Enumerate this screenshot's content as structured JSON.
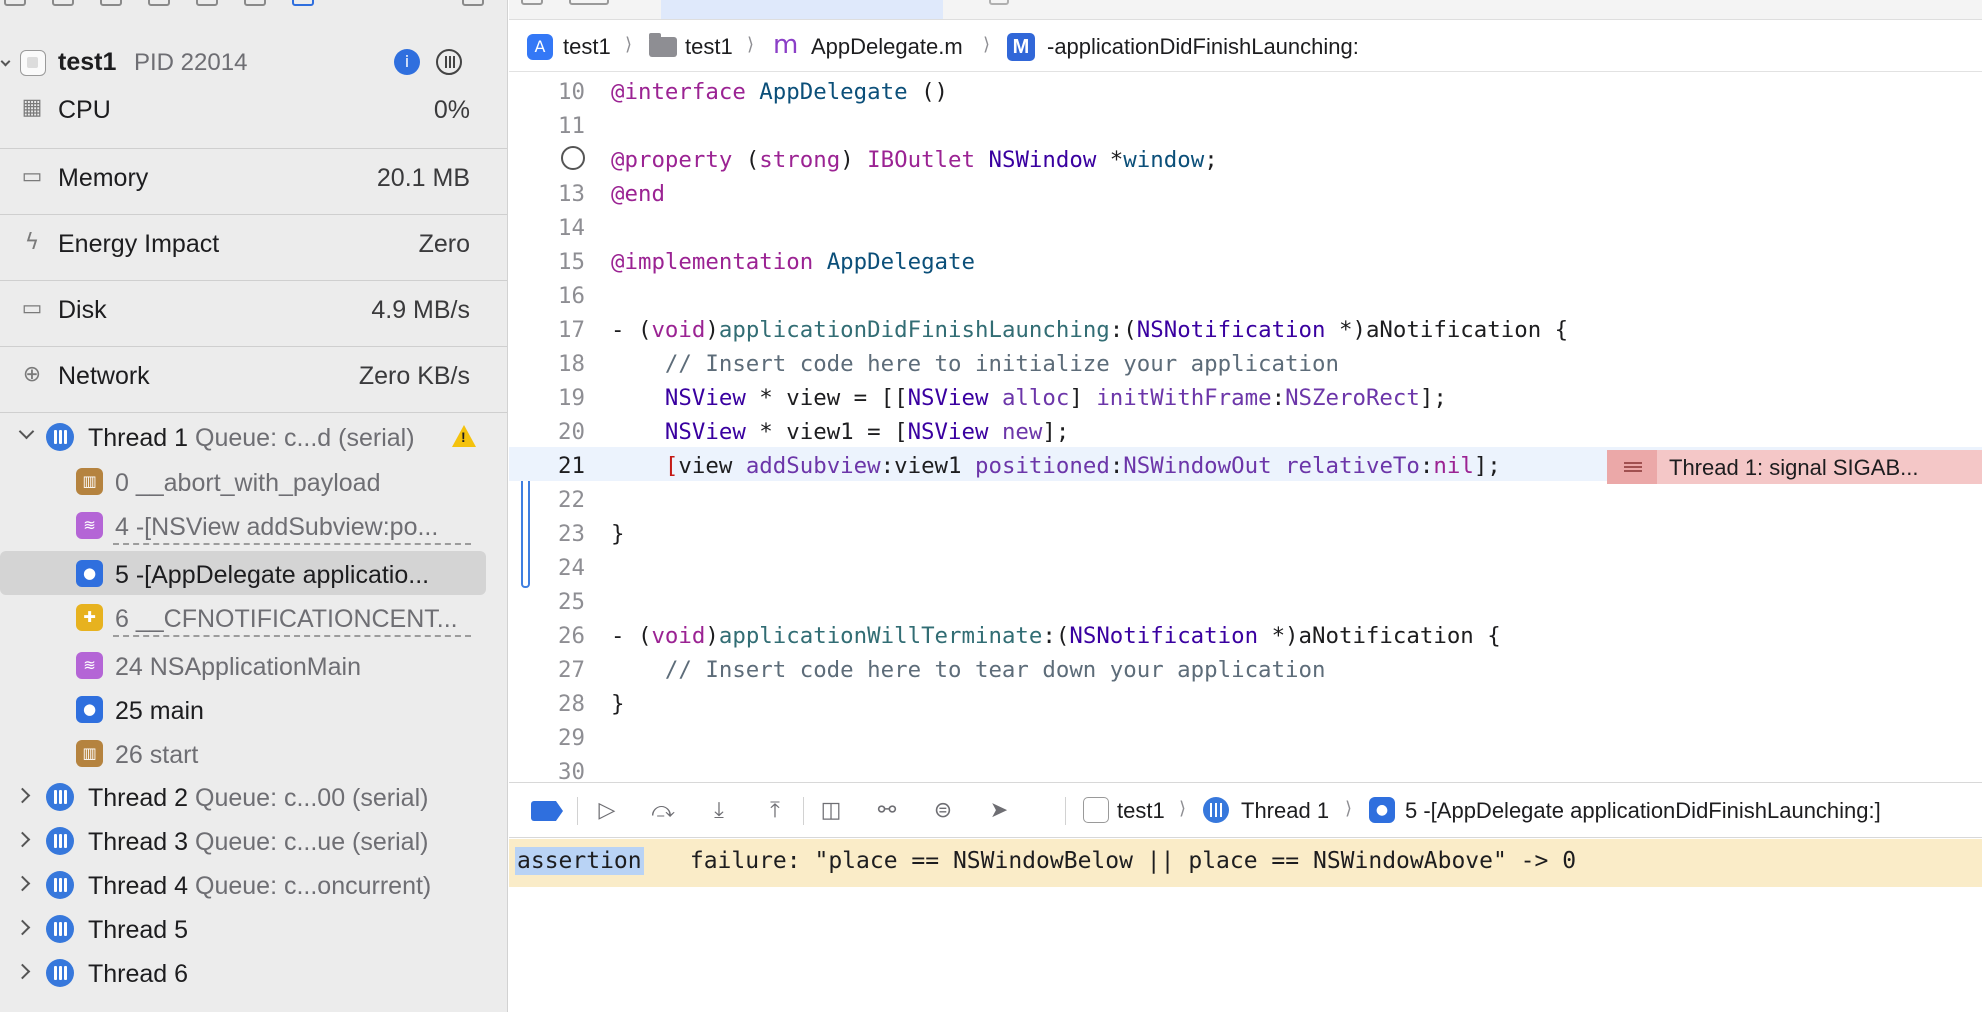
{
  "process": {
    "name": "test1",
    "pid": "PID 22014"
  },
  "gauges": [
    {
      "label": "CPU",
      "value": "0%",
      "icon": "cpu-icon"
    },
    {
      "label": "Memory",
      "value": "20.1 MB",
      "icon": "memory-icon"
    },
    {
      "label": "Energy Impact",
      "value": "Zero",
      "icon": "bolt-icon"
    },
    {
      "label": "Disk",
      "value": "4.9 MB/s",
      "icon": "disk-icon"
    },
    {
      "label": "Network",
      "value": "Zero KB/s",
      "icon": "globe-icon"
    }
  ],
  "threads": [
    {
      "name": "Thread 1",
      "queue": "Queue: c...d (serial)",
      "expanded": true,
      "warning": true
    },
    {
      "name": "Thread 2",
      "queue": "Queue: c...00 (serial)"
    },
    {
      "name": "Thread 3",
      "queue": "Queue: c...ue (serial)"
    },
    {
      "name": "Thread 4",
      "queue": "Queue: c...oncurrent)"
    },
    {
      "name": "Thread 5",
      "queue": ""
    },
    {
      "name": "Thread 6",
      "queue": ""
    }
  ],
  "frames": [
    {
      "label": "0 __abort_with_payload",
      "icon": "system-library-icon"
    },
    {
      "label": "4 -[NSView addSubview:po...",
      "icon": "framework-icon"
    },
    {
      "label": "5 -[AppDelegate applicatio...",
      "icon": "user-code-icon",
      "selected": true
    },
    {
      "label": "6 __CFNOTIFICATIONCENT...",
      "icon": "plugin-icon"
    },
    {
      "label": "24 NSApplicationMain",
      "icon": "framework-icon"
    },
    {
      "label": "25 main",
      "icon": "user-code-icon"
    },
    {
      "label": "26 start",
      "icon": "system-library-icon"
    }
  ],
  "breadcrumb": {
    "project": "test1",
    "folder": "test1",
    "file": "AppDelegate.m",
    "method": "-applicationDidFinishLaunching:"
  },
  "code": {
    "line_numbers": [
      "10",
      "11",
      "",
      "13",
      "14",
      "15",
      "16",
      "17",
      "18",
      "19",
      "20",
      "21",
      "22",
      "23",
      "24",
      "25",
      "26",
      "27",
      "28",
      "29",
      "30"
    ],
    "active_line": "21",
    "error_message": "Thread 1: signal SIGAB..."
  },
  "debug_bar": {
    "process": "test1",
    "thread": "Thread 1",
    "frame": "5 -[AppDelegate applicationDidFinishLaunching:]"
  },
  "console": {
    "highlight": "assertion",
    "text": " failure: \"place == NSWindowBelow || place == NSWindowAbove\" -> 0"
  },
  "colors": {
    "accent": "#2f6fde",
    "error_banner": "#f4c7c7",
    "console_highlight": "#faecc8",
    "keyword": "#9b2393"
  }
}
